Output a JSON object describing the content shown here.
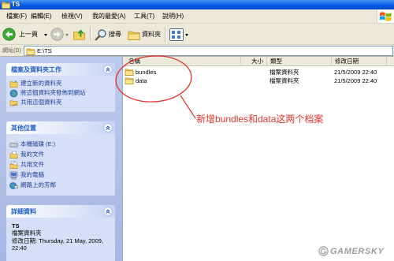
{
  "window": {
    "title": "TS"
  },
  "menu": {
    "items": [
      {
        "label": "檔案(F)"
      },
      {
        "label": "編輯(E)"
      },
      {
        "label": "檢視(V)"
      },
      {
        "label": "我的最愛(A)"
      },
      {
        "label": "工具(T)"
      },
      {
        "label": "說明(H)"
      }
    ],
    "logo_icon": "windows-logo-icon"
  },
  "toolbar": {
    "back": {
      "label": "上一頁",
      "icon": "back-arrow-icon"
    },
    "forward": {
      "icon": "forward-arrow-icon"
    },
    "up": {
      "icon": "up-folder-icon"
    },
    "search": {
      "label": "搜尋",
      "icon": "search-icon"
    },
    "folders": {
      "label": "資料夾",
      "icon": "folders-icon"
    },
    "views": {
      "icon": "views-icon"
    }
  },
  "address": {
    "label": "網址(D)",
    "value": "E:\\TS",
    "icon": "folder-icon"
  },
  "task_pane": {
    "file_folder_tasks": {
      "title": "檔案及資料夾工作",
      "items": [
        {
          "label": "建立新的資料夾",
          "icon": "new-folder-icon"
        },
        {
          "label": "將這個資料夾發佈到網站",
          "icon": "publish-web-icon"
        },
        {
          "label": "共用這個資料夾",
          "icon": "share-folder-icon"
        }
      ]
    },
    "other_places": {
      "title": "其他位置",
      "items": [
        {
          "label": "本機磁碟 (E:)",
          "icon": "local-disk-icon"
        },
        {
          "label": "我的文件",
          "icon": "my-documents-icon"
        },
        {
          "label": "共用文件",
          "icon": "shared-documents-icon"
        },
        {
          "label": "我的電腦",
          "icon": "my-computer-icon"
        },
        {
          "label": "網路上的芳鄰",
          "icon": "network-places-icon"
        }
      ]
    },
    "details": {
      "title": "詳細資料",
      "name": "TS",
      "type": "檔案資料夾",
      "modified": "修改日期: Thursday, 21 May, 2009, 22:40"
    }
  },
  "file_list": {
    "columns": {
      "name": "名稱",
      "size": "大小",
      "type": "類型",
      "modified": "修改日期"
    },
    "rows": [
      {
        "name": "bundles",
        "type": "檔案資料夾",
        "modified": "21/5/2009 22:40",
        "icon": "folder-icon"
      },
      {
        "name": "data",
        "type": "檔案資料夾",
        "modified": "21/5/2009 22:40",
        "icon": "folder-icon"
      }
    ]
  },
  "annotation": {
    "text": "新增bundles和data这两个档案"
  },
  "watermark": {
    "text": "GAMERSKY"
  },
  "colors": {
    "title_bar": "#0a5ce8",
    "chrome": "#ece9d8",
    "pane_bg": "#bccaeb",
    "panel_bg": "#d6dff7",
    "task_header_text": "#215dc6",
    "task_link": "#1c3f95",
    "annotation": "#e3342a"
  }
}
